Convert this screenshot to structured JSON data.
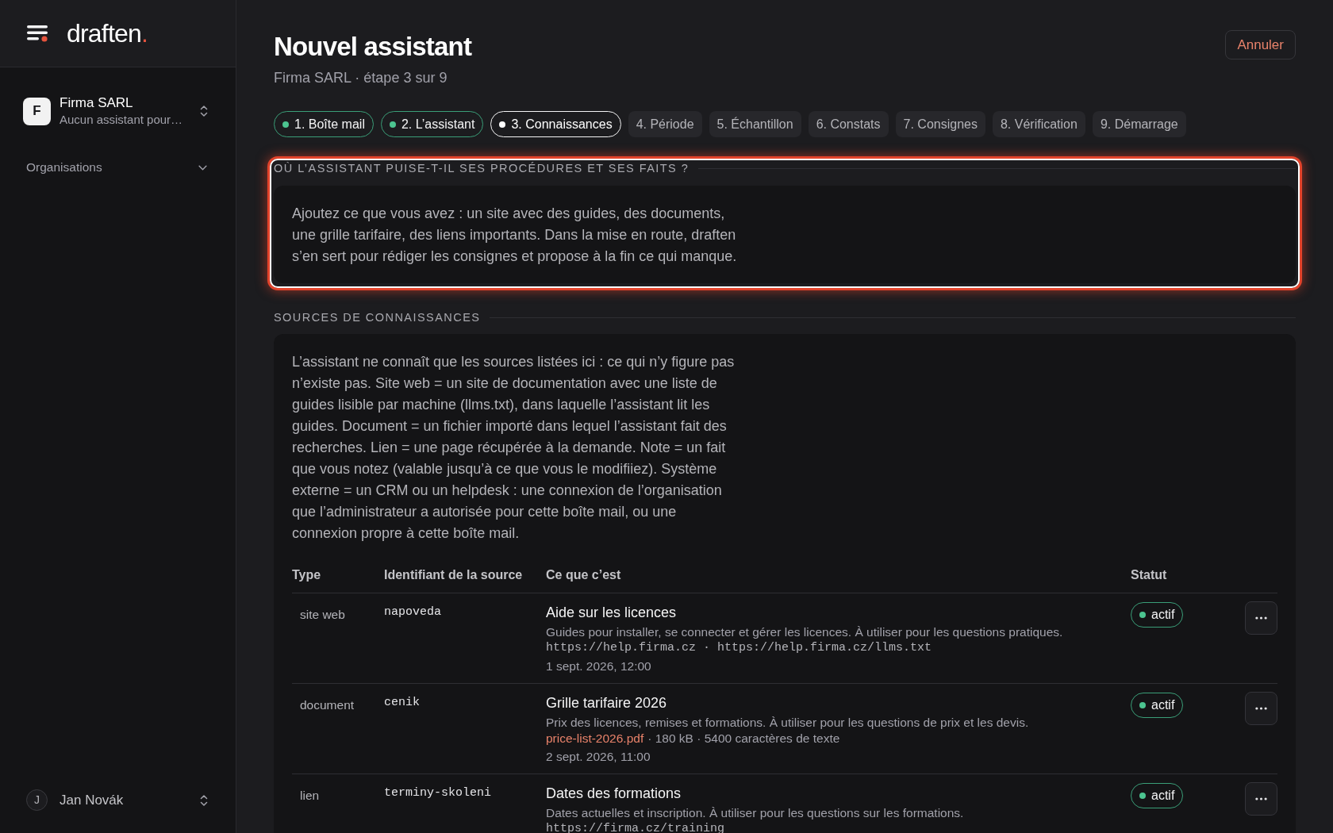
{
  "sidebar": {
    "brand": {
      "name": "draften",
      "dot": "."
    },
    "workspace": {
      "initial": "F",
      "name": "Firma SARL",
      "subtitle": "Aucun assistant pour…"
    },
    "nav": [
      {
        "label": "Organisations",
        "expanded": false
      }
    ],
    "user": {
      "initial": "J",
      "name": "Jan Novák"
    }
  },
  "header": {
    "title": "Nouvel assistant",
    "subtitle": "Firma SARL · étape 3 sur 9",
    "cancel_button": "Annuler"
  },
  "steps": [
    {
      "label": "1. Boîte mail",
      "completed": true,
      "selected": false
    },
    {
      "label": "2. L’assistant",
      "completed": true,
      "selected": false
    },
    {
      "label": "3. Connaissances",
      "completed": false,
      "selected": true
    },
    {
      "label": "4. Période",
      "completed": false,
      "selected": false
    },
    {
      "label": "5. Échantillon",
      "completed": false,
      "selected": false
    },
    {
      "label": "6. Constats",
      "completed": false,
      "selected": false
    },
    {
      "label": "7. Consignes",
      "completed": false,
      "selected": false
    },
    {
      "label": "8. Vérification",
      "completed": false,
      "selected": false
    },
    {
      "label": "9. Démarrage",
      "completed": false,
      "selected": false
    }
  ],
  "sections": [
    {
      "heading": "OÙ L’ASSISTANT PUISE-T-IL SES PROCÉDURES ET SES FAITS ?",
      "highlighted": true,
      "intro": "Ajoutez ce que vous avez : un site avec des guides, des documents, une grille tarifaire, des liens importants. Dans la mise en route, draften s’en sert pour rédiger les consignes et propose à la fin ce qui manque."
    },
    {
      "heading": "SOURCES DE CONNAISSANCES",
      "highlighted": false,
      "intro": "L’assistant ne connaît que les sources listées ici : ce qui n’y figure pas n’existe pas. Site web = un site de documentation avec une liste de guides lisible par machine (llms.txt), dans laquelle l’assistant lit les guides. Document = un fichier importé dans lequel l’assistant fait des recherches. Lien = une page récupérée à la demande. Note = un fait que vous notez (valable jusqu’à ce que vous le modifiiez). Système externe = un CRM ou un helpdesk : une connexion de l’organisation que l’administrateur a autorisée pour cette boîte mail, ou une connexion propre à cette boîte mail.",
      "table": {
        "columns": [
          "Type",
          "Identifiant de la source",
          "Ce que c’est",
          "Statut"
        ],
        "rows": [
          {
            "type": "site web",
            "identifier": "napoveda",
            "title": "Aide sur les licences",
            "description": "Guides pour installer, se connecter et gérer les licences. À utiliser pour les questions pratiques.",
            "details": [
              {
                "kind": "url",
                "text": "https://help.firma.cz · https://help.firma.cz/llms.txt"
              }
            ],
            "date": "1 sept. 2026, 12:00",
            "status": "actif"
          },
          {
            "type": "document",
            "identifier": "cenik",
            "title": "Grille tarifaire 2026",
            "description": "Prix des licences, remises et formations. À utiliser pour les questions de prix et les devis.",
            "details": [
              {
                "kind": "file",
                "text": "price-list-2026.pdf"
              },
              {
                "kind": "meta",
                "text": "· 180 kB · 5400 caractères de texte"
              }
            ],
            "date": "2 sept. 2026, 11:00",
            "status": "actif"
          },
          {
            "type": "lien",
            "identifier": "terminy-skoleni",
            "title": "Dates des formations",
            "description": "Dates actuelles et inscription. À utiliser pour les questions sur les formations.",
            "details": [
              {
                "kind": "url",
                "text": "https://firma.cz/training"
              }
            ],
            "status": "actif"
          }
        ]
      }
    }
  ]
}
